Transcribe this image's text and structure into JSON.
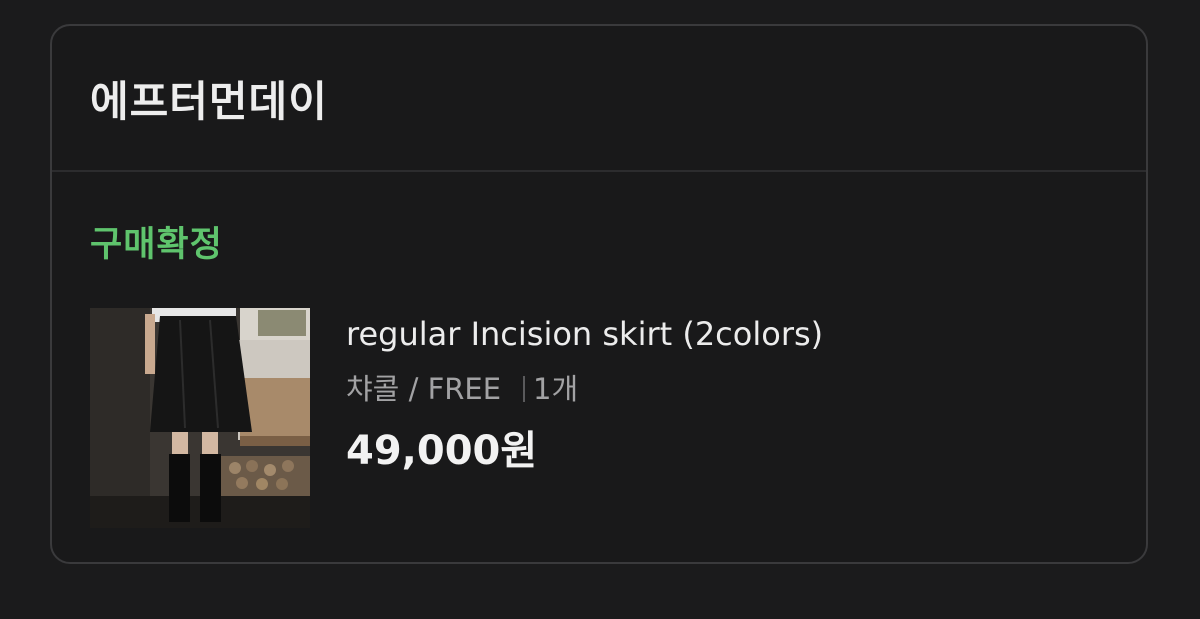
{
  "shop": {
    "name": "에프터먼데이"
  },
  "order": {
    "status": "구매확정",
    "status_color": "#5fc46d"
  },
  "product": {
    "image_icon": "product-photo-skirt",
    "title": "regular Incision skirt (2colors)",
    "option": "챠콜 / FREE",
    "quantity": "1개",
    "price": "49,000원"
  }
}
